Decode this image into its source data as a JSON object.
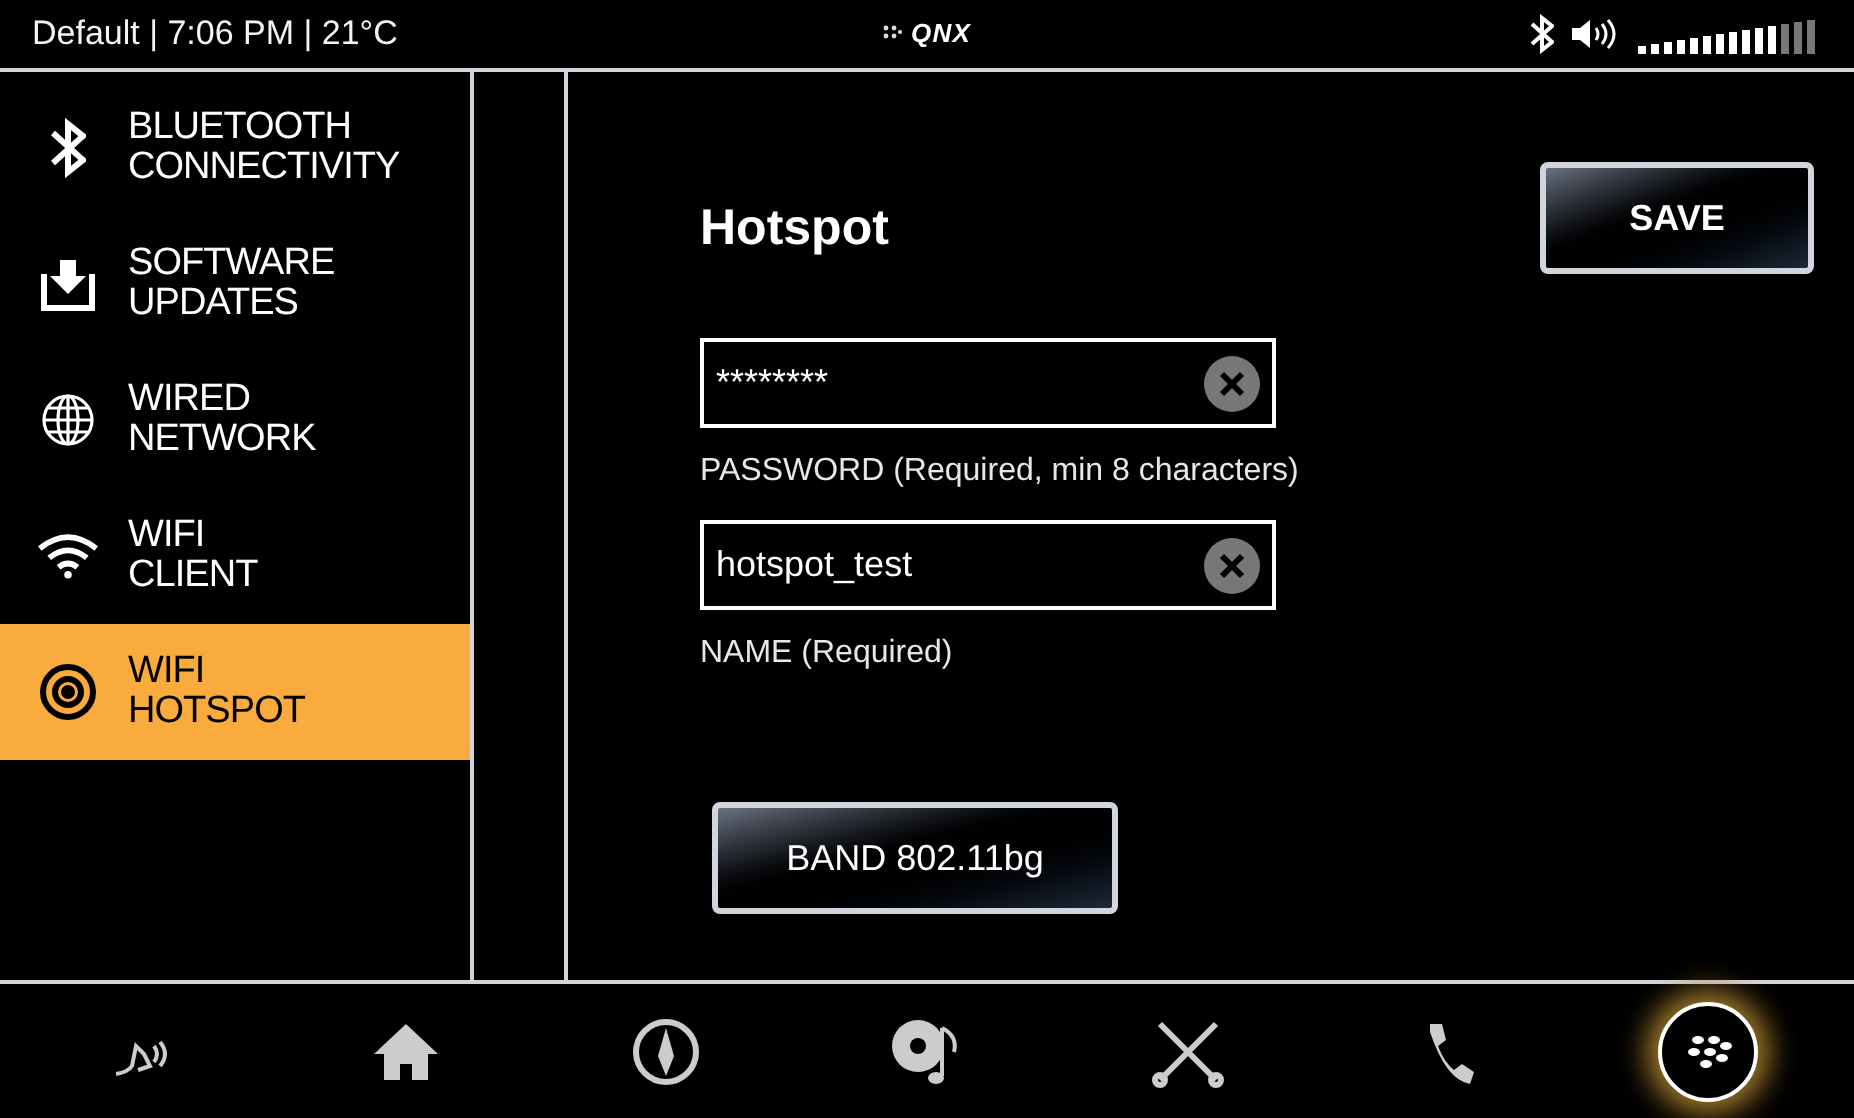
{
  "status_bar": {
    "info": "Default | 7:06 PM | 21°C",
    "logo": "QNX"
  },
  "sidebar": {
    "items": [
      {
        "label": "BLUETOOTH\nCONNECTIVITY",
        "kind": "bluetooth",
        "selected": false
      },
      {
        "label": "SOFTWARE\nUPDATES",
        "kind": "download",
        "selected": false
      },
      {
        "label": "WIRED\nNETWORK",
        "kind": "globe",
        "selected": false
      },
      {
        "label": "WIFI\nCLIENT",
        "kind": "wifi",
        "selected": false
      },
      {
        "label": "WIFI\nHOTSPOT",
        "kind": "target",
        "selected": true
      }
    ]
  },
  "main": {
    "title": "Hotspot",
    "save_button": "SAVE",
    "fields": [
      {
        "value": "********",
        "label": "PASSWORD (Required, min 8 characters)"
      },
      {
        "value": "hotspot_test",
        "label": "NAME (Required)"
      }
    ],
    "band_button": "BAND 802.11bg"
  },
  "dock": [
    {
      "kind": "voice",
      "selected": false
    },
    {
      "kind": "home",
      "selected": false
    },
    {
      "kind": "compass",
      "selected": false
    },
    {
      "kind": "music",
      "selected": false
    },
    {
      "kind": "tools",
      "selected": false
    },
    {
      "kind": "phone",
      "selected": false
    },
    {
      "kind": "apps",
      "selected": true
    }
  ]
}
